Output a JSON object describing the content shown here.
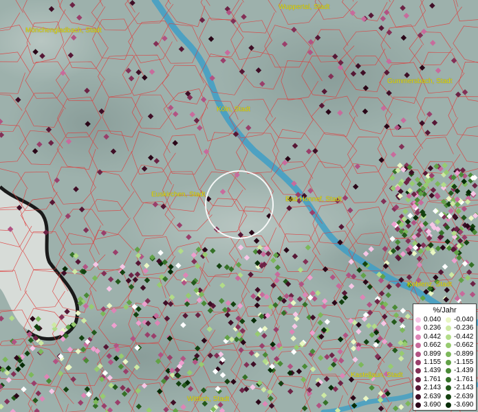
{
  "map": {
    "cities": [
      {
        "name": "Wuppertal, Stadt"
      },
      {
        "name": "Mönchengladbach, Stadt"
      },
      {
        "name": "Gummersbach, Stadt"
      },
      {
        "name": "Köln, Stadt"
      },
      {
        "name": "Euskirchen, Stadt"
      },
      {
        "name": "Bad Honnef, Stadt"
      },
      {
        "name": "Koblenz, Stadt"
      },
      {
        "name": "Kastellaun, Stadt"
      },
      {
        "name": "Wittlich, Stadt"
      }
    ],
    "colors": {
      "terrain": "#9fb3ae",
      "river": "#3f9fc6",
      "district_border": "#e03a3a",
      "state_border": "#1a1a1a",
      "label": "#e8e000"
    }
  },
  "legend": {
    "title": "%/Jahr",
    "positive": [
      {
        "value": "0.040",
        "color": "#f7c6e6"
      },
      {
        "value": "0.236",
        "color": "#ee9fcf"
      },
      {
        "value": "0.442",
        "color": "#dd85b6"
      },
      {
        "value": "0.662",
        "color": "#c86b9c"
      },
      {
        "value": "0.899",
        "color": "#b25383"
      },
      {
        "value": "1.155",
        "color": "#9a3f6b"
      },
      {
        "value": "1.439",
        "color": "#833056"
      },
      {
        "value": "1.761",
        "color": "#6c2345"
      },
      {
        "value": "2.143",
        "color": "#561735"
      },
      {
        "value": "2.639",
        "color": "#3f0e26"
      },
      {
        "value": "3.690",
        "color": "#2a0718"
      }
    ],
    "negative": [
      {
        "value": "-0.040",
        "color": "#eaf7c4"
      },
      {
        "value": "-0.236",
        "color": "#cde9a3"
      },
      {
        "value": "-0.442",
        "color": "#b2dc88"
      },
      {
        "value": "-0.662",
        "color": "#97cb70"
      },
      {
        "value": "-0.899",
        "color": "#7cb85a"
      },
      {
        "value": "-1.155",
        "color": "#62a247"
      },
      {
        "value": "-1.439",
        "color": "#4a8a36"
      },
      {
        "value": "-1.761",
        "color": "#357127"
      },
      {
        "value": "-2.143",
        "color": "#23591b"
      },
      {
        "value": "-2.639",
        "color": "#144210"
      },
      {
        "value": "-3.690",
        "color": "#072c07"
      }
    ]
  }
}
